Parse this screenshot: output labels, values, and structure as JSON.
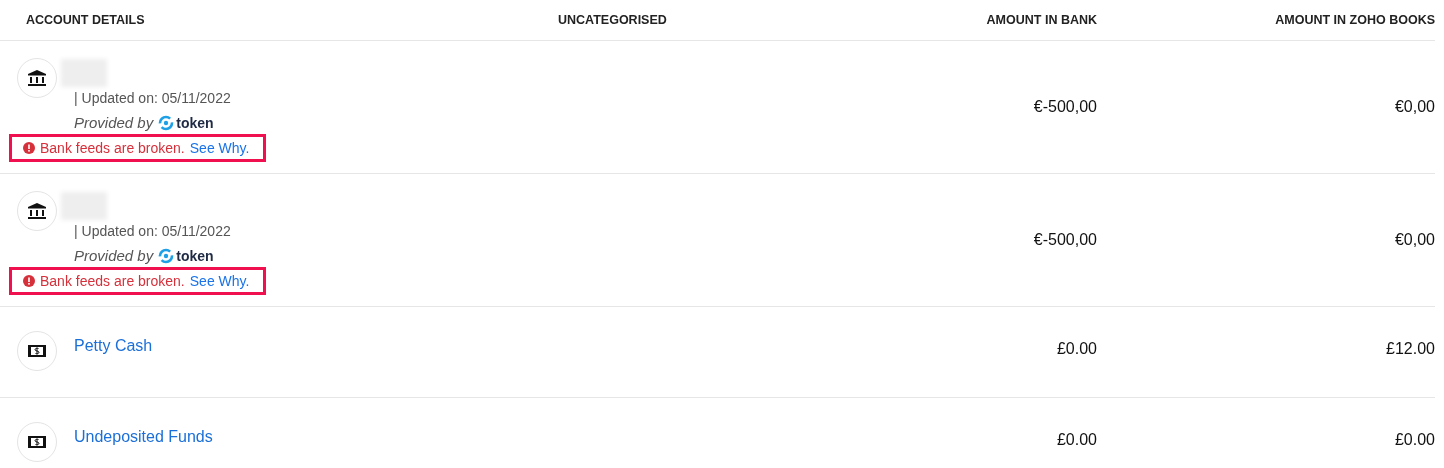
{
  "table": {
    "columns": [
      "ACCOUNT DETAILS",
      "UNCATEGORISED",
      "AMOUNT IN BANK",
      "AMOUNT IN ZOHO BOOKS"
    ],
    "rows": [
      {
        "kind": "bank",
        "name_redacted": true,
        "updated": "| Updated on: 05/11/2022",
        "provided_by": "Provided by",
        "provider": "token",
        "alert": {
          "message": "Bank feeds are broken.",
          "link": "See Why.",
          "highlighted": true
        },
        "amount_in_bank": "€-500,00",
        "amount_in_books": "€0,00"
      },
      {
        "kind": "bank",
        "name_redacted": true,
        "updated": "| Updated on: 05/11/2022",
        "provided_by": "Provided by",
        "provider": "token",
        "alert": {
          "message": "Bank feeds are broken.",
          "link": "See Why.",
          "highlighted": true
        },
        "amount_in_bank": "€-500,00",
        "amount_in_books": "€0,00"
      },
      {
        "kind": "cash",
        "name": "Petty Cash",
        "amount_in_bank": "£0.00",
        "amount_in_books": "£12.00"
      },
      {
        "kind": "cash",
        "name": "Undeposited Funds",
        "amount_in_bank": "£0.00",
        "amount_in_books": "£0.00"
      }
    ]
  }
}
